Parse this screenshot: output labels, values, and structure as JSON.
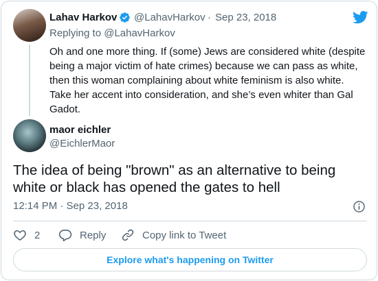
{
  "reply_tweet": {
    "author_name": "Lahav Harkov",
    "handle": "@LahavHarkov",
    "separator": "·",
    "date": "Sep 23, 2018",
    "replying_to": "Replying to @LahavHarkov",
    "body": "Oh and one more thing. If (some) Jews are considered white (despite being a major victim of hate crimes) because we can pass as white, then this woman complaining about white feminism is also white. Take her accent into consideration, and she’s even whiter than Gal Gadot."
  },
  "main_tweet": {
    "author_name": "maor eichler",
    "handle": "@EichlerMaor",
    "body": "The idea of being \"brown\" as an alternative to being white or black has opened the gates to hell",
    "timestamp": "12:14 PM · Sep 23, 2018"
  },
  "actions": {
    "like_count": "2",
    "reply_label": "Reply",
    "copy_link_label": "Copy link to Tweet"
  },
  "explore_label": "Explore what's happening on Twitter",
  "icons": {
    "verified": "verified-badge-icon",
    "brand": "twitter-bird-icon",
    "info": "info-icon",
    "like": "heart-icon",
    "reply": "reply-icon",
    "copy_link": "link-icon"
  },
  "colors": {
    "brand_blue": "#1d9bf0",
    "text": "#0f1419",
    "muted": "#536471",
    "border": "#cfd9de"
  }
}
